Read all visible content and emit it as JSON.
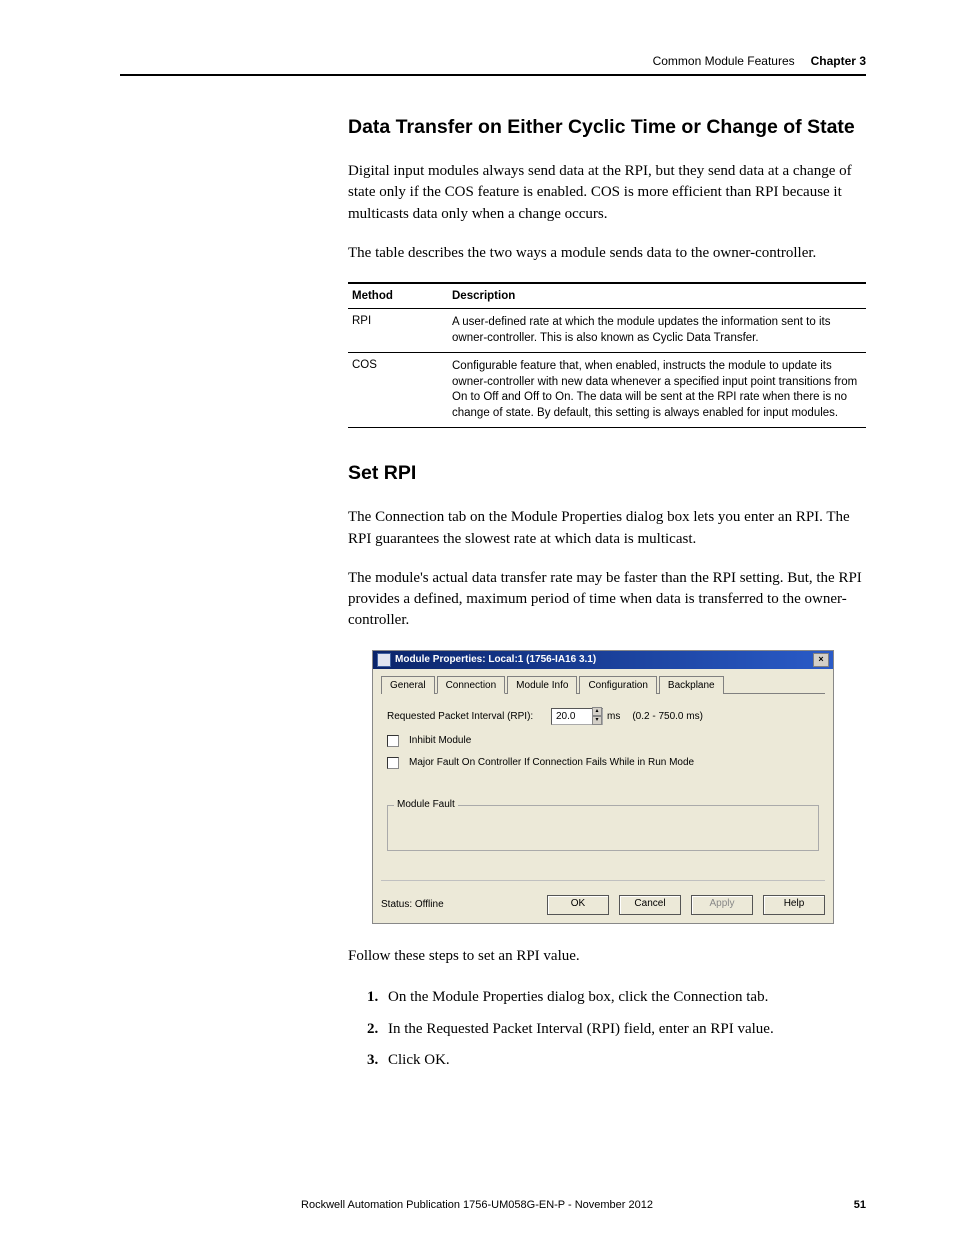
{
  "header": {
    "section": "Common Module Features",
    "chapter": "Chapter 3"
  },
  "sec1": {
    "title": "Data Transfer on Either Cyclic Time or Change of State",
    "p1": "Digital input modules always send data at the RPI, but they send data at a change of state only if the COS feature is enabled. COS is more efficient than RPI because it multicasts data only when a change occurs.",
    "p2": "The table describes the two ways a module sends data to the owner-controller."
  },
  "table": {
    "h1": "Method",
    "h2": "Description",
    "rows": [
      {
        "method": "RPI",
        "desc": "A user-defined rate at which the module updates the information sent to its owner-controller. This is also known as Cyclic Data Transfer."
      },
      {
        "method": "COS",
        "desc": "Configurable feature that, when enabled, instructs the module to update its owner-controller with new data whenever a specified input point transitions from On to Off and Off to On. The data will be sent at the RPI rate when there is no change of state. By default, this setting is always enabled for input modules."
      }
    ]
  },
  "sec2": {
    "title": "Set RPI",
    "p1": "The Connection tab on the Module Properties dialog box lets you enter an RPI. The RPI guarantees the slowest rate at which data is multicast.",
    "p2": "The module's actual data transfer rate may be faster than the RPI setting. But, the RPI provides a defined, maximum period of time when data is transferred to the owner-controller."
  },
  "dialog": {
    "title": "Module Properties: Local:1 (1756-IA16 3.1)",
    "tabs": {
      "general": "General",
      "connection": "Connection",
      "moduleinfo": "Module Info",
      "configuration": "Configuration",
      "backplane": "Backplane"
    },
    "rpi_label": "Requested Packet Interval (RPI):",
    "rpi_value": "20.0",
    "rpi_unit": "ms",
    "rpi_range": "(0.2 - 750.0 ms)",
    "inhibit": "Inhibit Module",
    "majorfault": "Major Fault On Controller If Connection Fails While in Run Mode",
    "modulefault": "Module Fault",
    "status": "Status: Offline",
    "buttons": {
      "ok": "OK",
      "cancel": "Cancel",
      "apply": "Apply",
      "help": "Help"
    }
  },
  "sec3": {
    "lead": "Follow these steps to set an RPI value.",
    "steps": [
      "On the Module Properties dialog box, click the Connection tab.",
      "In the Requested Packet Interval (RPI) field, enter an RPI value.",
      "Click OK."
    ]
  },
  "footer": {
    "text": "Rockwell Automation Publication 1756-UM058G-EN-P - November 2012",
    "page": "51"
  }
}
